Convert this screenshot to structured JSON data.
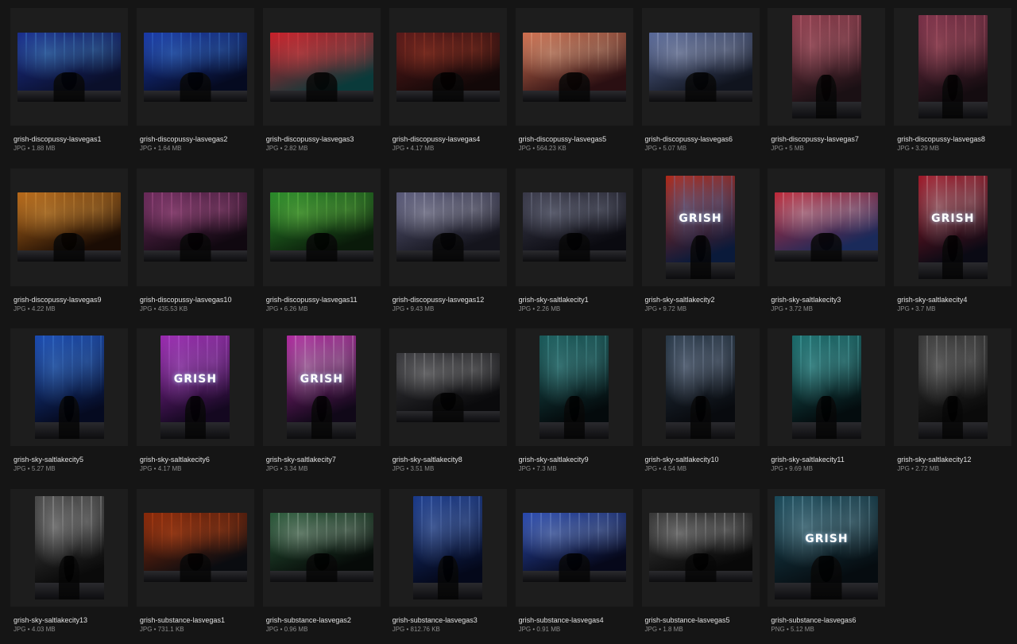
{
  "files": [
    {
      "name": "grish-discopussy-lasvegas1",
      "type": "JPG",
      "size": "1.88 MB",
      "orientation": "landscape",
      "colors": [
        "#1b2f8f",
        "#0a0f2a",
        "#6fd0ff"
      ],
      "has_logo": false
    },
    {
      "name": "grish-discopussy-lasvegas2",
      "type": "JPG",
      "size": "1.64 MB",
      "orientation": "landscape",
      "colors": [
        "#1a3aa8",
        "#050a20",
        "#5aa8ff"
      ],
      "has_logo": false
    },
    {
      "name": "grish-discopussy-lasvegas3",
      "type": "JPG",
      "size": "2.82 MB",
      "orientation": "landscape",
      "colors": [
        "#c8202a",
        "#0a3a3a",
        "#ff5a5a"
      ],
      "has_logo": false
    },
    {
      "name": "grish-discopussy-lasvegas4",
      "type": "JPG",
      "size": "4.17 MB",
      "orientation": "landscape",
      "colors": [
        "#5a1a1a",
        "#120808",
        "#e05a3a"
      ],
      "has_logo": false
    },
    {
      "name": "grish-discopussy-lasvegas5",
      "type": "JPG",
      "size": "564.23 KB",
      "orientation": "landscape",
      "colors": [
        "#d07050",
        "#2a0f12",
        "#ffe0c0"
      ],
      "has_logo": false
    },
    {
      "name": "grish-discopussy-lasvegas6",
      "type": "JPG",
      "size": "5.07 MB",
      "orientation": "landscape",
      "colors": [
        "#5a6a9a",
        "#10141e",
        "#e0e8ff"
      ],
      "has_logo": false
    },
    {
      "name": "grish-discopussy-lasvegas7",
      "type": "JPG",
      "size": "5 MB",
      "orientation": "portrait",
      "colors": [
        "#8a3a4a",
        "#1a1014",
        "#ff9aa8"
      ],
      "has_logo": false
    },
    {
      "name": "grish-discopussy-lasvegas8",
      "type": "JPG",
      "size": "3.29 MB",
      "orientation": "portrait",
      "colors": [
        "#7a3048",
        "#140c10",
        "#ff8a9a"
      ],
      "has_logo": false
    },
    {
      "name": "grish-discopussy-lasvegas9",
      "type": "JPG",
      "size": "4.22 MB",
      "orientation": "landscape",
      "colors": [
        "#b86a1a",
        "#1a0c04",
        "#ffc060"
      ],
      "has_logo": false
    },
    {
      "name": "grish-discopussy-lasvegas10",
      "type": "JPG",
      "size": "435.53 KB",
      "orientation": "landscape",
      "colors": [
        "#6a2a5a",
        "#100810",
        "#ff8ad0"
      ],
      "has_logo": false
    },
    {
      "name": "grish-discopussy-lasvegas11",
      "type": "JPG",
      "size": "6.26 MB",
      "orientation": "landscape",
      "colors": [
        "#2a8a2a",
        "#0a1a0a",
        "#a0ff6a"
      ],
      "has_logo": false
    },
    {
      "name": "grish-discopussy-lasvegas12",
      "type": "JPG",
      "size": "9.43 MB",
      "orientation": "landscape",
      "colors": [
        "#5a5a7a",
        "#14141c",
        "#f0f0ff"
      ],
      "has_logo": false
    },
    {
      "name": "grish-sky-saltlakecity1",
      "type": "JPG",
      "size": "2.26 MB",
      "orientation": "landscape",
      "colors": [
        "#3a3a4a",
        "#0a0a10",
        "#c0c8e0"
      ],
      "has_logo": false
    },
    {
      "name": "grish-sky-saltlakecity2",
      "type": "JPG",
      "size": "9.72 MB",
      "orientation": "portrait",
      "colors": [
        "#b02a1a",
        "#0a1a3a",
        "#5ab0ff"
      ],
      "has_logo": true
    },
    {
      "name": "grish-sky-saltlakecity3",
      "type": "JPG",
      "size": "3.72 MB",
      "orientation": "landscape",
      "colors": [
        "#c02a3a",
        "#1a2a5a",
        "#ffffff"
      ],
      "has_logo": false
    },
    {
      "name": "grish-sky-saltlakecity4",
      "type": "JPG",
      "size": "3.7 MB",
      "orientation": "portrait",
      "colors": [
        "#a01a2a",
        "#0a0a14",
        "#ffffff"
      ],
      "has_logo": true
    },
    {
      "name": "grish-sky-saltlakecity5",
      "type": "JPG",
      "size": "5.27 MB",
      "orientation": "portrait",
      "colors": [
        "#1a4ab0",
        "#050a20",
        "#6ab0ff"
      ],
      "has_logo": false
    },
    {
      "name": "grish-sky-saltlakecity6",
      "type": "JPG",
      "size": "4.17 MB",
      "orientation": "portrait",
      "colors": [
        "#9a2ab0",
        "#140820",
        "#e090ff"
      ],
      "has_logo": true
    },
    {
      "name": "grish-sky-saltlakecity7",
      "type": "JPG",
      "size": "3.34 MB",
      "orientation": "portrait",
      "colors": [
        "#b02aa0",
        "#100818",
        "#ffffff"
      ],
      "has_logo": true
    },
    {
      "name": "grish-sky-saltlakecity8",
      "type": "JPG",
      "size": "3.51 MB",
      "orientation": "landscape",
      "colors": [
        "#3a3a3e",
        "#0a0a0c",
        "#e0e0e0"
      ],
      "has_logo": false
    },
    {
      "name": "grish-sky-saltlakecity9",
      "type": "JPG",
      "size": "7.3 MB",
      "orientation": "portrait",
      "colors": [
        "#1a5a5a",
        "#040a0c",
        "#80e0e0"
      ],
      "has_logo": false
    },
    {
      "name": "grish-sky-saltlakecity10",
      "type": "JPG",
      "size": "4.54 MB",
      "orientation": "portrait",
      "colors": [
        "#2a3a4a",
        "#080a0e",
        "#d0e0ff"
      ],
      "has_logo": false
    },
    {
      "name": "grish-sky-saltlakecity11",
      "type": "JPG",
      "size": "9.69 MB",
      "orientation": "portrait",
      "colors": [
        "#1a6a6a",
        "#040c0e",
        "#90ffff"
      ],
      "has_logo": false
    },
    {
      "name": "grish-sky-saltlakecity12",
      "type": "JPG",
      "size": "2.72 MB",
      "orientation": "portrait",
      "colors": [
        "#3a3a3a",
        "#0a0a0a",
        "#d0d0d0"
      ],
      "has_logo": false
    },
    {
      "name": "grish-sky-saltlakecity13",
      "type": "JPG",
      "size": "4.03 MB",
      "orientation": "portrait",
      "colors": [
        "#4a4a4a",
        "#0a0a0a",
        "#ffffff"
      ],
      "has_logo": false
    },
    {
      "name": "grish-substance-lasvegas1",
      "type": "JPG",
      "size": "731.1 KB",
      "orientation": "landscape",
      "colors": [
        "#8a2a0a",
        "#0a0c10",
        "#ff6a2a"
      ],
      "has_logo": false
    },
    {
      "name": "grish-substance-lasvegas2",
      "type": "JPG",
      "size": "0.96 MB",
      "orientation": "landscape",
      "colors": [
        "#2a5a3a",
        "#060a08",
        "#f0fff0"
      ],
      "has_logo": false
    },
    {
      "name": "grish-substance-lasvegas3",
      "type": "JPG",
      "size": "812.76 KB",
      "orientation": "portrait",
      "colors": [
        "#1a3a8a",
        "#04081a",
        "#a0c0ff"
      ],
      "has_logo": false
    },
    {
      "name": "grish-substance-lasvegas4",
      "type": "JPG",
      "size": "0.91 MB",
      "orientation": "landscape",
      "colors": [
        "#2a4ab0",
        "#06081a",
        "#c0d8ff"
      ],
      "has_logo": false
    },
    {
      "name": "grish-substance-lasvegas5",
      "type": "JPG",
      "size": "1.8 MB",
      "orientation": "landscape",
      "colors": [
        "#3a3a3a",
        "#080808",
        "#ffffff"
      ],
      "has_logo": false
    },
    {
      "name": "grish-substance-lasvegas6",
      "type": "PNG",
      "size": "5.12 MB",
      "orientation": "square",
      "colors": [
        "#1a4a5a",
        "#060c10",
        "#c0f0ff"
      ],
      "has_logo": true
    }
  ],
  "logo_text": "GRISH"
}
